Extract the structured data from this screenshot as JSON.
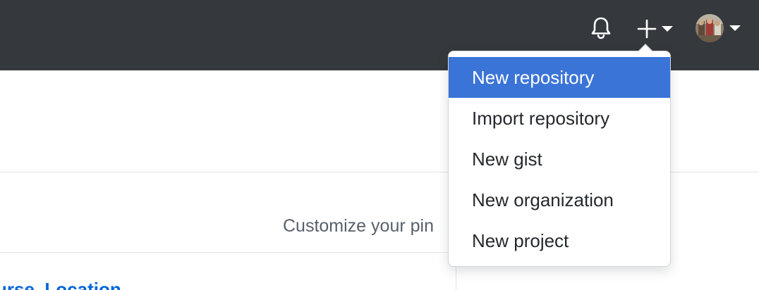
{
  "header": {
    "background_color": "#35393e",
    "notifications_icon": "bell-icon",
    "create_icon": "plus-icon",
    "create_dropdown_icon": "caret-down-icon",
    "avatar_dropdown_icon": "caret-down-icon"
  },
  "create_menu": {
    "items": [
      {
        "label": "New repository",
        "active": true
      },
      {
        "label": "Import repository",
        "active": false
      },
      {
        "label": "New gist",
        "active": false
      },
      {
        "label": "New organization",
        "active": false
      },
      {
        "label": "New project",
        "active": false
      }
    ],
    "highlight_color": "#3b74d7"
  },
  "content": {
    "customize_text": "Customize your pin",
    "repo_link_text": "urse_Location",
    "link_color": "#0366d6"
  }
}
